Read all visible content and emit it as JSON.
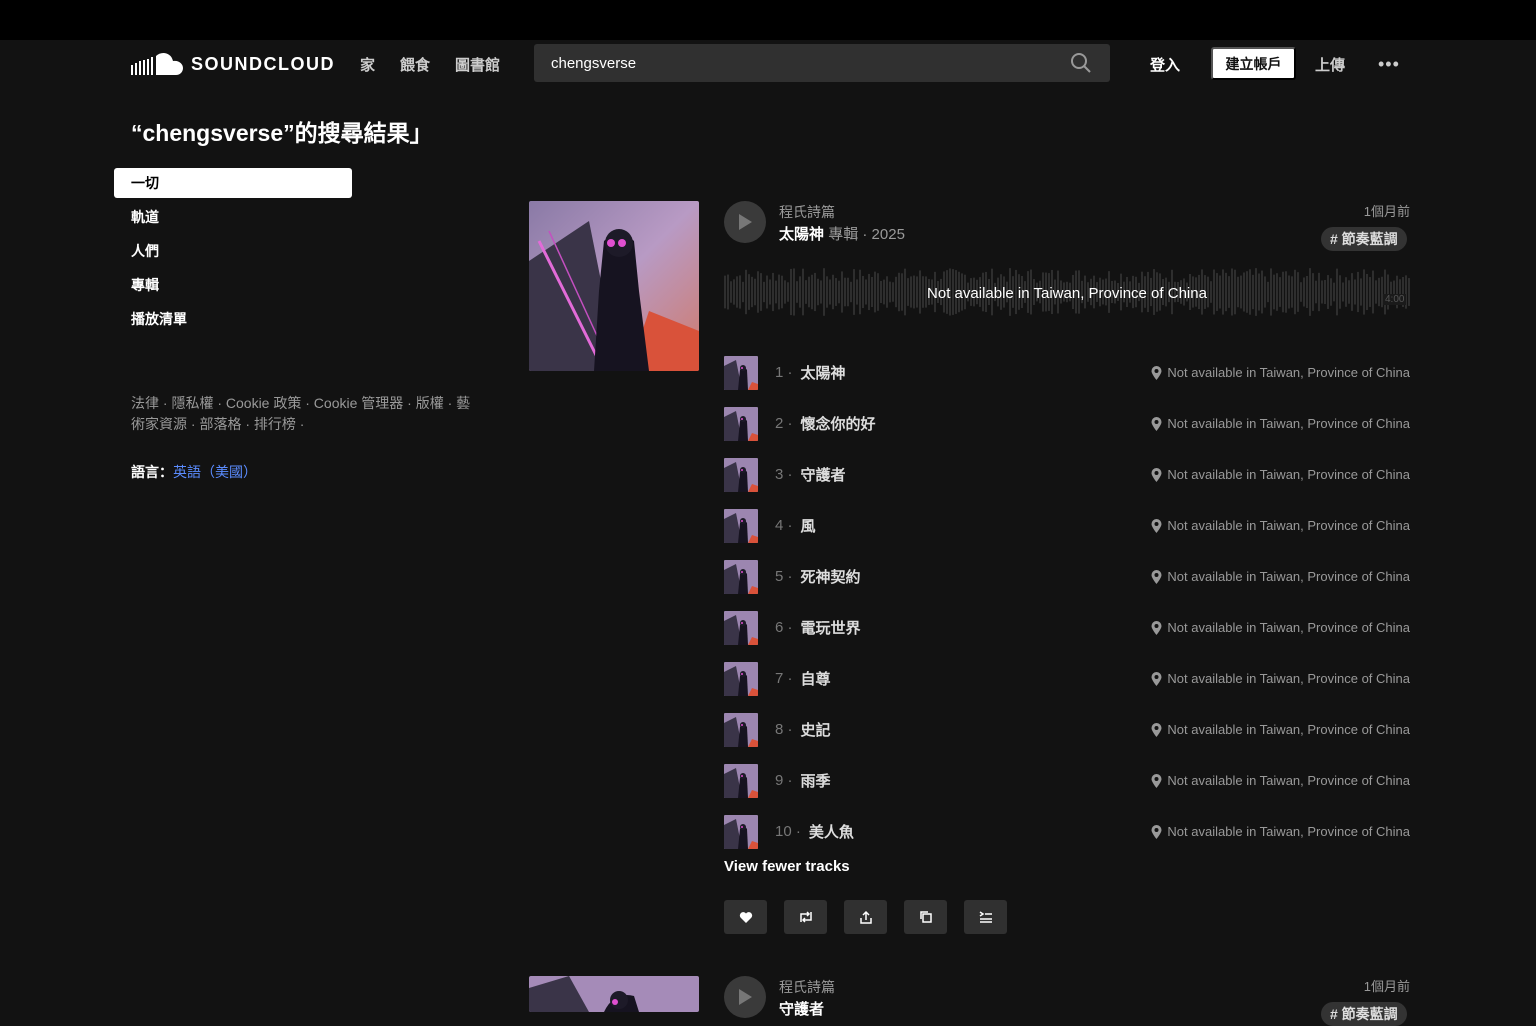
{
  "header": {
    "logo_text": "SOUNDCLOUD",
    "nav": [
      "家",
      "餵食",
      "圖書館"
    ],
    "search_value": "chengsverse",
    "sign_in": "登入",
    "create_account": "建立帳戶",
    "upload": "上傳",
    "more": "•••"
  },
  "page_title": "“chengsverse”的搜尋結果」",
  "filters": [
    "一切",
    "軌道",
    "人們",
    "專輯",
    "播放清單"
  ],
  "footer": {
    "links": "法律 · 隱私權 · Cookie 政策 · Cookie 管理器 · 版權 · 藝術家資源 · 部落格 · 排行榜 ·",
    "language_label": "語言：",
    "language_value": "英語（美國）"
  },
  "result1": {
    "artist": "程氏詩篇",
    "title": "太陽神",
    "kind": "專輯",
    "year": "· 2025",
    "age": "1個月前",
    "tag": "# 節奏藍調",
    "wave_message": "Not available in Taiwan, Province of China",
    "duration": "4:00",
    "tracks": [
      {
        "num": "1 ·",
        "title": "太陽神",
        "status": "Not available in Taiwan, Province of China"
      },
      {
        "num": "2 ·",
        "title": "懷念你的好",
        "status": "Not available in Taiwan, Province of China"
      },
      {
        "num": "3 ·",
        "title": "守護者",
        "status": "Not available in Taiwan, Province of China"
      },
      {
        "num": "4 ·",
        "title": "風",
        "status": "Not available in Taiwan, Province of China"
      },
      {
        "num": "5 ·",
        "title": "死神契約",
        "status": "Not available in Taiwan, Province of China"
      },
      {
        "num": "6 ·",
        "title": "電玩世界",
        "status": "Not available in Taiwan, Province of China"
      },
      {
        "num": "7 ·",
        "title": "自尊",
        "status": "Not available in Taiwan, Province of China"
      },
      {
        "num": "8 ·",
        "title": "史記",
        "status": "Not available in Taiwan, Province of China"
      },
      {
        "num": "9 ·",
        "title": "雨季",
        "status": "Not available in Taiwan, Province of China"
      },
      {
        "num": "10 ·",
        "title": "美人魚",
        "status": "Not available in Taiwan, Province of China"
      }
    ],
    "view_fewer": "View fewer tracks",
    "actions": [
      "heart-icon",
      "repost-icon",
      "share-icon",
      "copy-link-icon",
      "add-to-playlist-icon"
    ]
  },
  "result2": {
    "artist": "程氏詩篇",
    "title": "守護者",
    "age": "1個月前",
    "tag": "# 節奏藍調"
  }
}
